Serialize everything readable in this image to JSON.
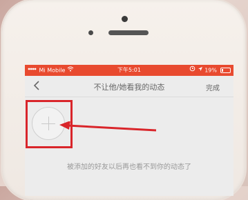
{
  "status_bar": {
    "carrier": "Mi Mobile",
    "time": "下午5:01",
    "battery_text": "19%",
    "battery_level": 0.19
  },
  "nav": {
    "title": "不让他/她看我的动态",
    "done_label": "完成"
  },
  "content": {
    "hint_text": "被添加的好友以后再也看不到你的动态了"
  },
  "colors": {
    "status_bar_bg": "#e84a2f",
    "highlight": "#d9252a"
  },
  "icons": {
    "back": "chevron-left-icon",
    "add": "plus-icon",
    "wifi": "wifi-icon",
    "location": "location-arrow-icon",
    "alarm": "alarm-icon"
  }
}
